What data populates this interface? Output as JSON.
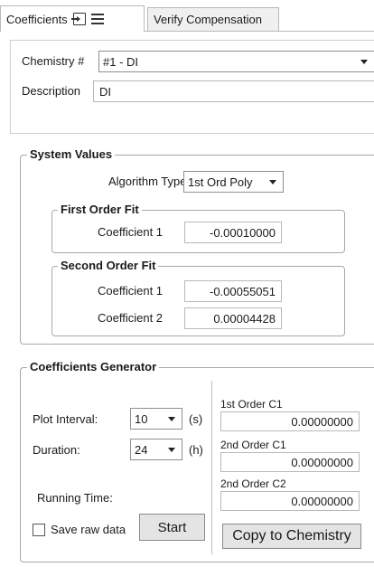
{
  "tabs": [
    {
      "label": "Coefficients",
      "icons": [
        "export-icon",
        "menu-icon"
      ],
      "active": true
    },
    {
      "label": "Verify Compensation",
      "active": false
    }
  ],
  "chemistry": {
    "label": "Chemistry #",
    "selected": "#1  -  DI",
    "description_label": "Description",
    "description_value": "DI"
  },
  "system_values": {
    "title": "System Values",
    "algorithm_label": "Algorithm Type",
    "algorithm_value": "1st Ord Poly",
    "first_order": {
      "title": "First Order Fit",
      "c1_label": "Coefficient 1",
      "c1_value": "-0.00010000"
    },
    "second_order": {
      "title": "Second Order Fit",
      "c1_label": "Coefficient 1",
      "c1_value": "-0.00055051",
      "c2_label": "Coefficient 2",
      "c2_value": "0.00004428"
    }
  },
  "generator": {
    "title": "Coefficients Generator",
    "plot_interval_label": "Plot Interval:",
    "plot_interval_value": "10",
    "plot_interval_unit": "(s)",
    "duration_label": "Duration:",
    "duration_value": "24",
    "duration_unit": "(h)",
    "running_time_label": "Running Time:",
    "save_raw_label": "Save raw data",
    "save_raw_checked": false,
    "start_label": "Start",
    "first_c1_label": "1st Order C1",
    "first_c1_value": "0.00000000",
    "second_c1_label": "2nd Order C1",
    "second_c1_value": "0.00000000",
    "second_c2_label": "2nd Order C2",
    "second_c2_value": "0.00000000",
    "copy_label": "Copy to Chemistry"
  }
}
